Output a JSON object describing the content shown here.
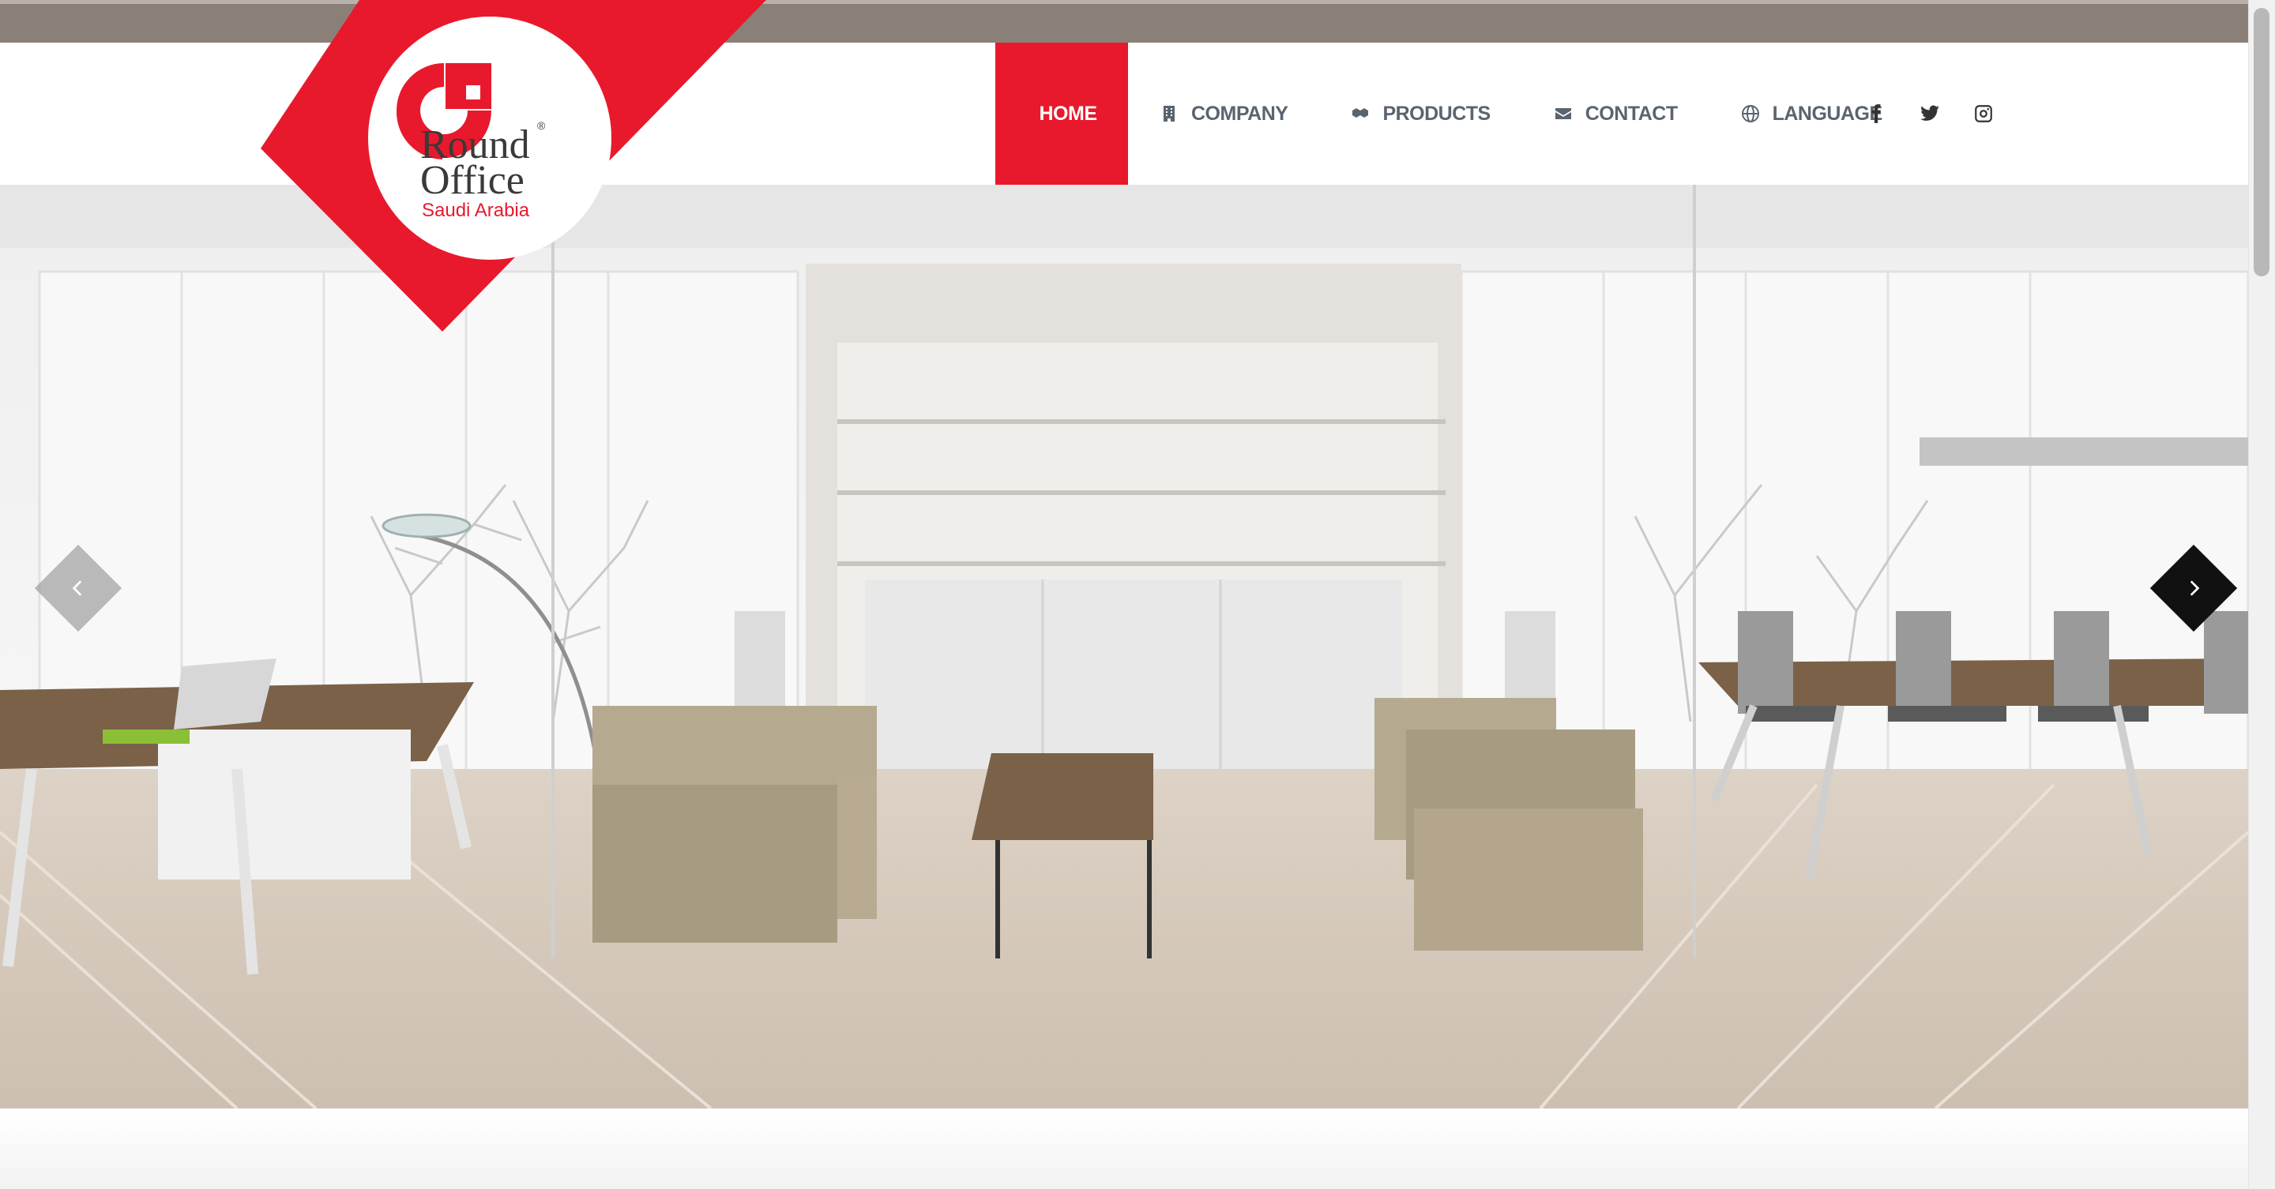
{
  "brand": {
    "name_line1": "Round",
    "name_line2": "Office",
    "subtitle": "Saudi Arabia",
    "registered_mark": "®",
    "color": "#e8192c"
  },
  "nav": {
    "items": [
      {
        "label": "HOME",
        "icon": "home-icon",
        "active": true
      },
      {
        "label": "COMPANY",
        "icon": "building-icon",
        "active": false
      },
      {
        "label": "PRODUCTS",
        "icon": "cubes-icon",
        "active": false
      },
      {
        "label": "CONTACT",
        "icon": "envelope-icon",
        "active": false
      },
      {
        "label": "LANGUAGE",
        "icon": "globe-icon",
        "active": false
      }
    ]
  },
  "social": {
    "items": [
      {
        "name": "facebook-icon"
      },
      {
        "name": "twitter-icon"
      },
      {
        "name": "instagram-icon"
      }
    ]
  },
  "slider": {
    "image_alt": "Modern office interior with lounge sofas, desk and meeting table",
    "prev_icon": "chevron-left-icon",
    "next_icon": "chevron-right-icon"
  },
  "colors": {
    "accent": "#e8192c",
    "nav_text": "#5a6470",
    "top_strip": "#8a8078"
  }
}
